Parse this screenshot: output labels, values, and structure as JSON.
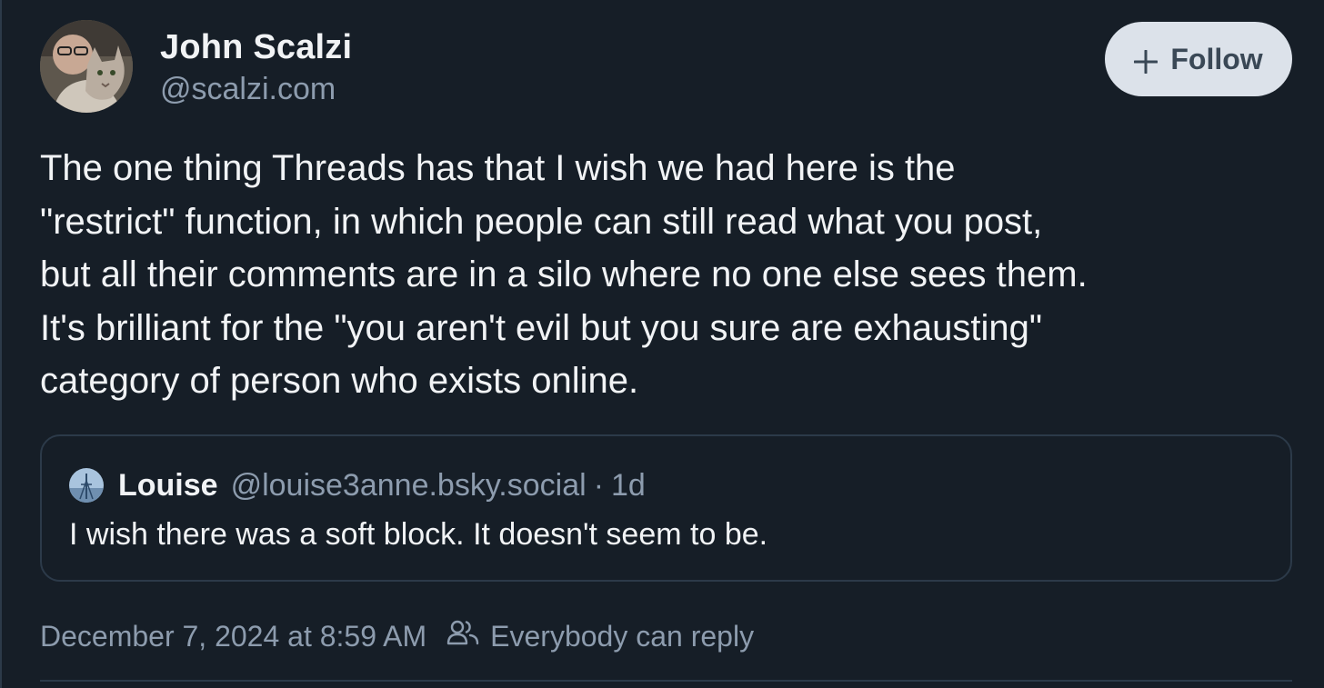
{
  "author": {
    "display_name": "John Scalzi",
    "handle": "@scalzi.com"
  },
  "follow_button": {
    "label": "Follow",
    "icon": "plus-icon"
  },
  "post": {
    "text": "The one thing Threads has that I wish we had here is the\n\"restrict\" function, in which people can still read what you post,\nbut all their comments are in a silo where no one else sees them.\nIt's brilliant for the \"you aren't evil but you sure are exhausting\"\ncategory of person who exists online."
  },
  "quote": {
    "display_name": "Louise",
    "handle": "@louise3anne.bsky.social",
    "separator": "·",
    "age": "1d",
    "text": "I wish there was a soft block. It doesn't seem to be."
  },
  "meta": {
    "timestamp": "December 7, 2024 at 8:59 AM",
    "reply_setting": "Everybody can reply",
    "reply_icon": "people-icon"
  },
  "colors": {
    "background": "#161e27",
    "text": "#f1f3f5",
    "muted": "#8d9cae",
    "border": "#2c3a49",
    "follow_bg": "#dce2ea",
    "follow_text": "#3a4856"
  }
}
